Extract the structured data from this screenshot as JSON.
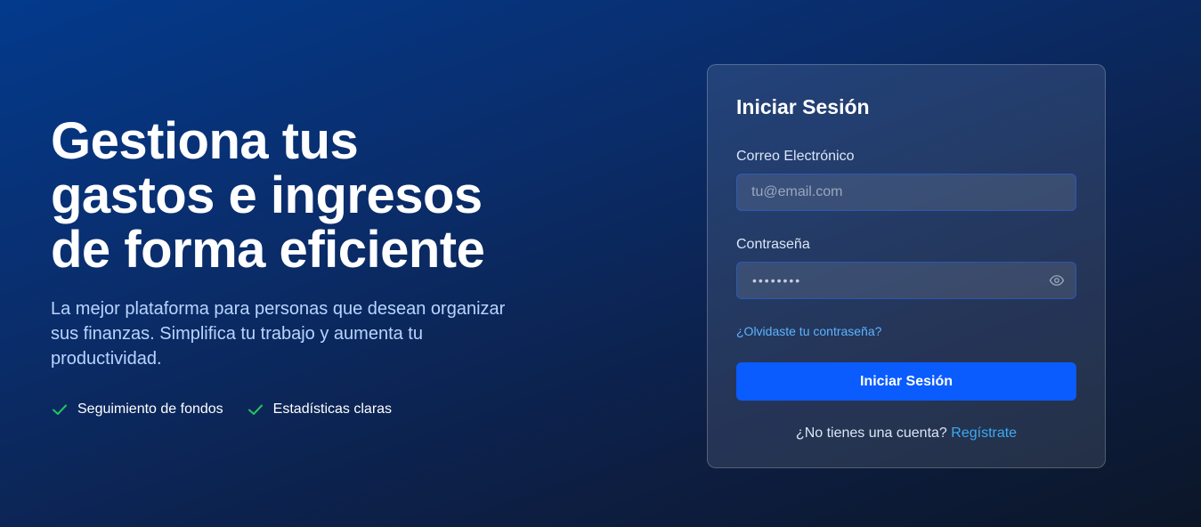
{
  "hero": {
    "title_lines": [
      "Gestiona tus",
      "gastos e ingresos",
      "de forma eficiente"
    ],
    "subtitle_lines": [
      "La mejor plataforma para personas que desean organizar",
      "sus finanzas. Simplifica tu trabajo y aumenta tu",
      "productividad."
    ],
    "features": [
      {
        "icon": "check-icon",
        "label": "Seguimiento de fondos"
      },
      {
        "icon": "check-icon",
        "label": "Estadísticas claras"
      }
    ]
  },
  "login": {
    "title": "Iniciar Sesión",
    "email_label": "Correo Electrónico",
    "email_placeholder": "tu@email.com",
    "email_value": "",
    "password_label": "Contraseña",
    "password_mask": "••••••••",
    "password_toggle_icon": "eye-icon",
    "forgot_link": "¿Olvidaste tu contraseña?",
    "submit_label": "Iniciar Sesión",
    "signup_prompt": "¿No tienes una cuenta?",
    "signup_link": "Regístrate"
  },
  "colors": {
    "accent": "#0a5cff",
    "link": "#5cb4ff",
    "check": "#22c55e"
  }
}
